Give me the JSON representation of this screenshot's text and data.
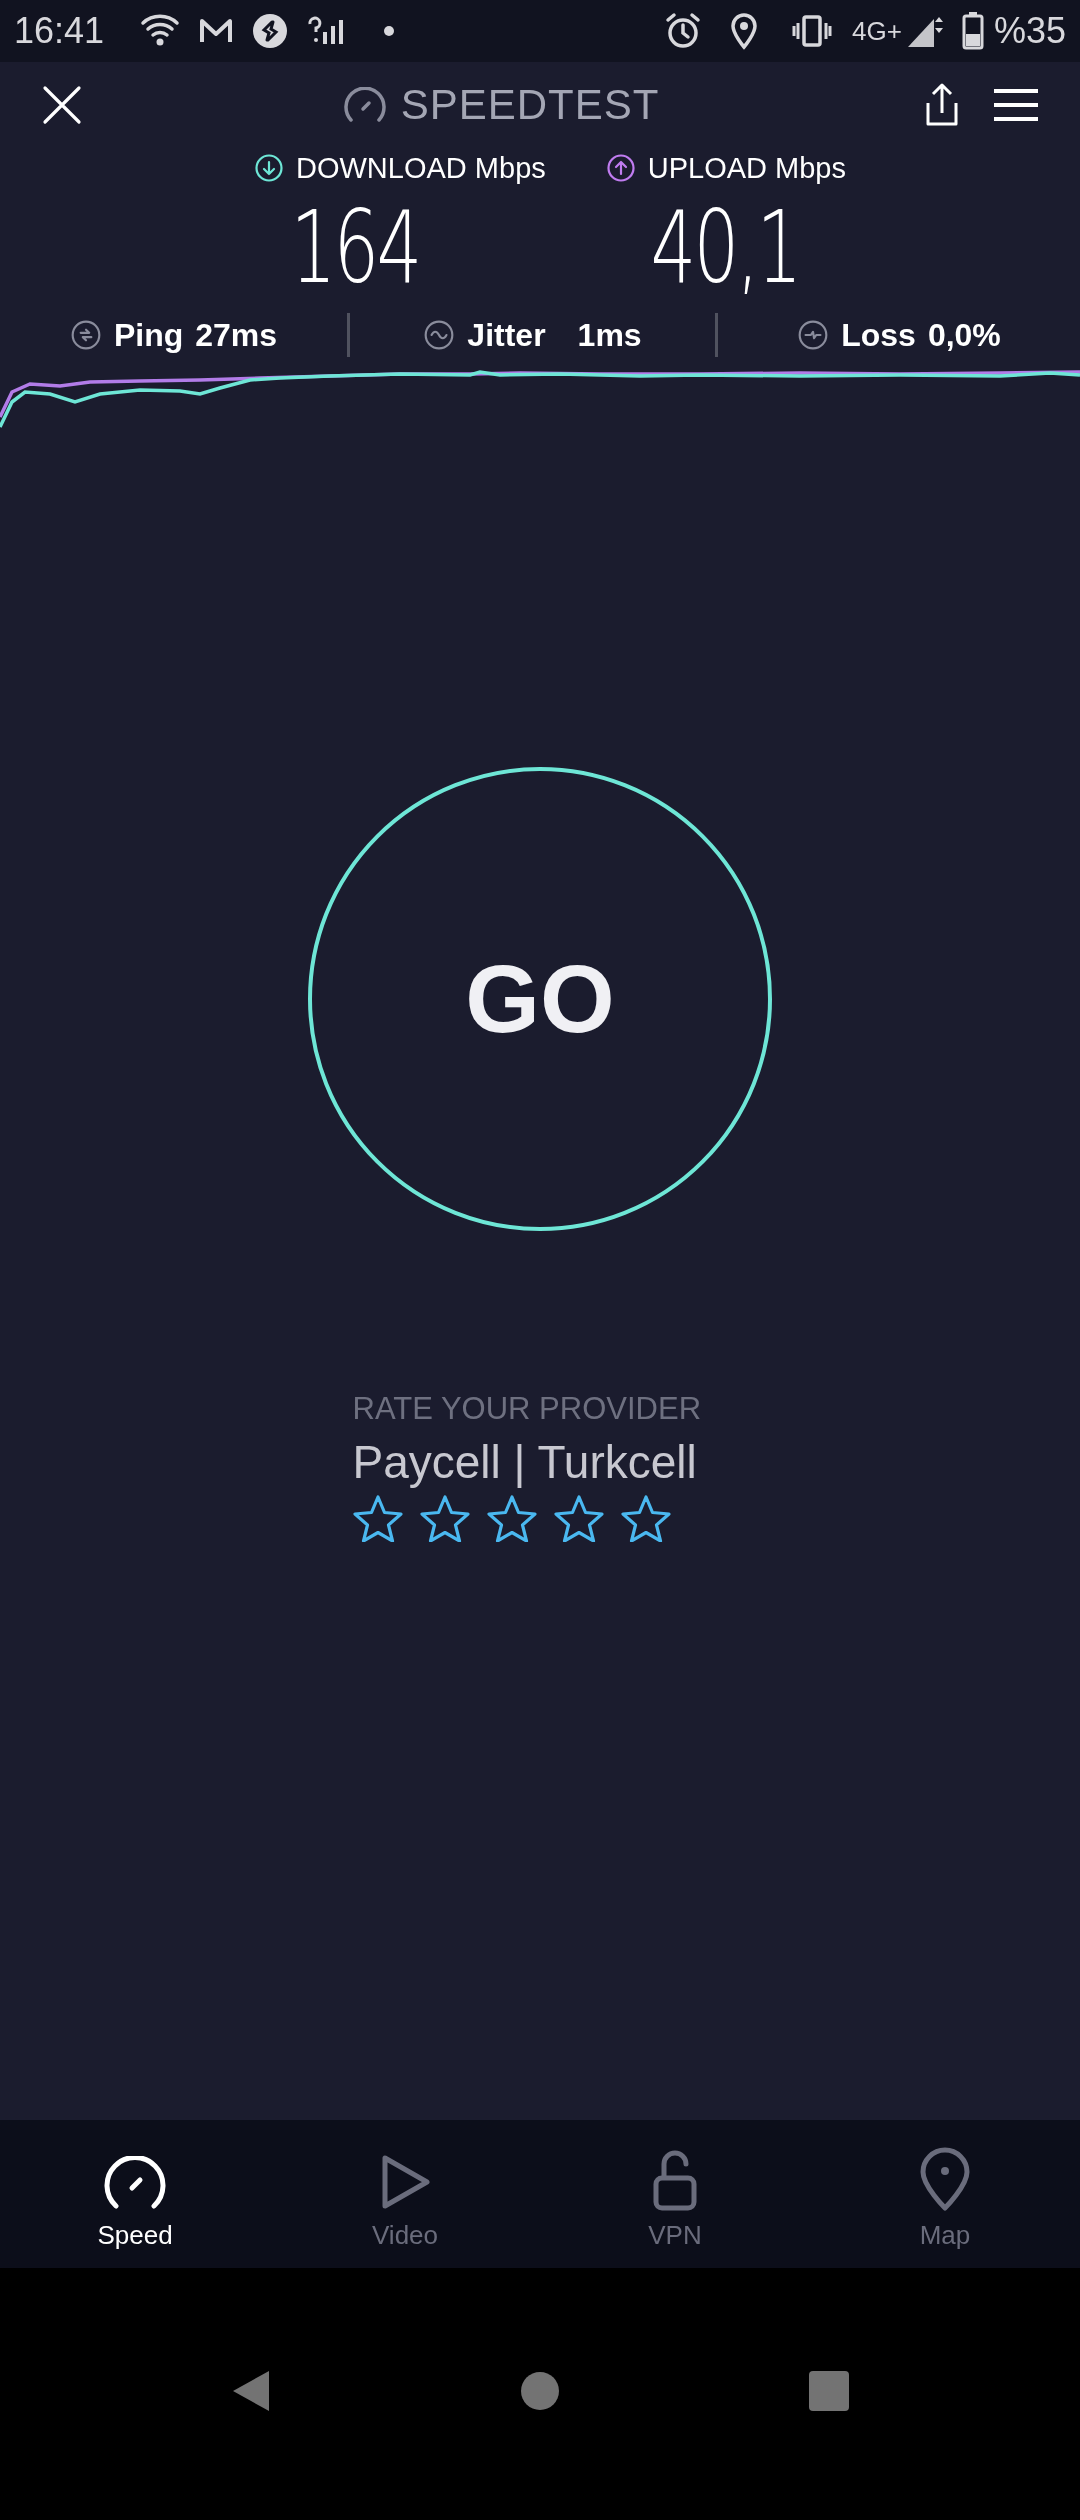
{
  "status_bar": {
    "time": "16:41",
    "network": "4G+",
    "battery": "%35"
  },
  "app_bar": {
    "title": "SPEEDTEST"
  },
  "results": [
    {
      "kind": "download",
      "label": "DOWNLOAD Mbps",
      "value": "164"
    },
    {
      "kind": "upload",
      "label": "UPLOAD Mbps",
      "value": "40,1"
    }
  ],
  "metrics": [
    {
      "kind": "ping",
      "label": "Ping",
      "value": "27ms"
    },
    {
      "kind": "jitter",
      "label": "Jitter",
      "value": "1ms"
    },
    {
      "kind": "loss",
      "label": "Loss",
      "value": "0,0%"
    }
  ],
  "go_button": {
    "label": "GO"
  },
  "rating": {
    "heading": "RATE YOUR PROVIDER",
    "provider": "Paycell | Turkcell",
    "stars": 0
  },
  "tabs": [
    {
      "kind": "speed",
      "label": "Speed",
      "selected": true
    },
    {
      "kind": "video",
      "label": "Video",
      "selected": false
    },
    {
      "kind": "vpn",
      "label": "VPN",
      "selected": false
    },
    {
      "kind": "map",
      "label": "Map",
      "selected": false
    }
  ]
}
